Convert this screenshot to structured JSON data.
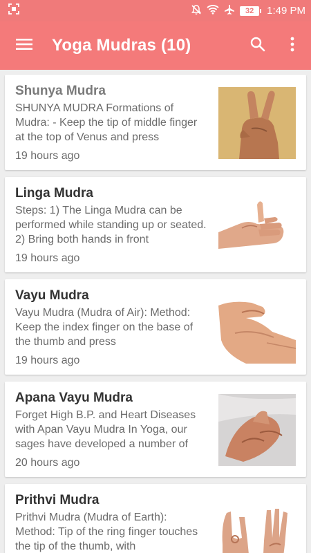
{
  "status_bar": {
    "time": "1:49 PM",
    "battery": "32",
    "icons": [
      "screenshot-icon",
      "notifications-off-icon",
      "wifi-icon",
      "airplane-icon",
      "battery-icon"
    ]
  },
  "app_bar": {
    "title": "Yoga Mudras (10)",
    "icons": [
      "menu-icon",
      "search-icon",
      "more-vert-icon"
    ],
    "color": "#f47a7a"
  },
  "items": [
    {
      "title": "Shunya Mudra",
      "description": "SHUNYA MUDRA Formations of Mudra: - Keep the tip of middle finger at the top of Venus and press",
      "time": "19 hours ago",
      "image": "hand-gesture-photo"
    },
    {
      "title": "Linga Mudra",
      "description": "Steps: 1) The Linga Mudra can be performed while standing up or seated. 2) Bring both hands in front",
      "time": "19 hours ago",
      "image": "clasped-hands-photo"
    },
    {
      "title": "Vayu Mudra",
      "description": "Vayu Mudra (Mudra of Air): Method: Keep the index finger on the base of the thumb and press",
      "time": "19 hours ago",
      "image": "hand-gesture-photo"
    },
    {
      "title": "Apana Vayu Mudra",
      "description": "Forget High B.P. and Heart Diseases with Apan Vayu Mudra In Yoga, our sages have developed a number of",
      "time": "20 hours ago",
      "image": "hand-gesture-photo"
    },
    {
      "title": "Prithvi Mudra",
      "description": "Prithvi Mudra (Mudra of Earth): Method: Tip of the ring finger touches the tip of the thumb, with",
      "time": "",
      "image": "two-hands-photo"
    }
  ]
}
